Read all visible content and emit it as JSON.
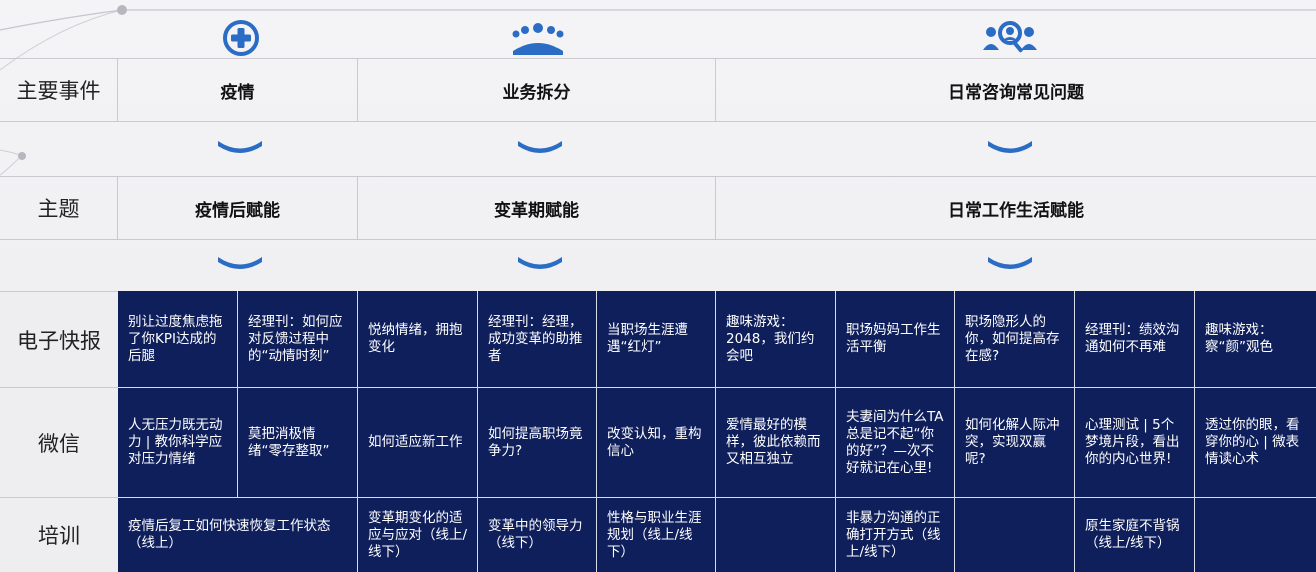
{
  "rows": {
    "events_label": "主要事件",
    "theme_label": "主题",
    "newsletter_label": "电子快报",
    "wechat_label": "微信",
    "training_label": "培训"
  },
  "events": [
    "疫情",
    "业务拆分",
    "日常咨询常见问题"
  ],
  "themes": [
    "疫情后赋能",
    "变革期赋能",
    "日常工作生活赋能"
  ],
  "icons": [
    "medical-cross-icon",
    "group-meeting-icon",
    "consulting-people-icon"
  ],
  "colors": {
    "navy": "#0f1f5c",
    "accent_blue": "#2b6cc4",
    "grid_line": "#d7dbe8"
  },
  "newsletter": [
    "别让过度焦虑拖了你KPI达成的后腿",
    "经理刊：如何应对反馈过程中的“动情时刻”",
    "悦纳情绪，拥抱变化",
    "经理刊：经理，成功变革的助推者",
    "当职场生涯遭遇“红灯”",
    "趣味游戏：2048，我们约会吧",
    "职场妈妈工作生活平衡",
    "职场隐形人的你，如何提高存在感?",
    "经理刊：绩效沟通如何不再难",
    "趣味游戏：察“颜”观色"
  ],
  "wechat": [
    "人无压力既无动力 | 教你科学应对压力情绪",
    "莫把消极情绪“零存整取”",
    "如何适应新工作",
    "如何提高职场竟争力?",
    "改变认知，重构信心",
    "爱情最好的模样，彼此依赖而又相互独立",
    "夫妻间为什么TA总是记不起“你的好”？—次不好就记在心里!",
    "如何化解人际冲突，实现双赢呢?",
    "心理测试 | 5个梦境片段，看出你的内心世界!",
    "透过你的眼，看穿你的心 | 微表情读心术"
  ],
  "training": [
    "疫情后复工如何快速恢复工作状态（线上）",
    "变革期变化的适应与应对（线上/线下）",
    "变革中的领导力（线下）",
    "性格与职业生涯规划（线上/线下）",
    "",
    "非暴力沟通的正确打开方式（线上/线下）",
    "",
    "原生家庭不背锅（线上/线下）",
    ""
  ]
}
